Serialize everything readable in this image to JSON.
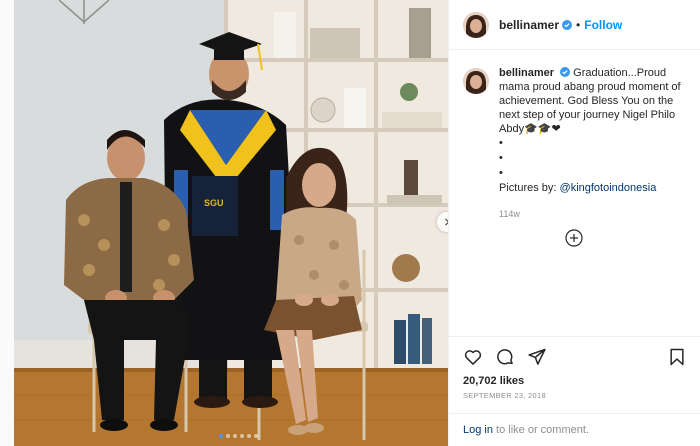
{
  "post": {
    "username": "bellinamer",
    "follow_label": "Follow",
    "separator": "•",
    "caption_text": "Graduation...Proud mama proud abang proud moment of achievement. God Bless You on the next step of your journey Nigel Philo Abdy🎓🎓❤",
    "caption_bullets": [
      "•",
      "•",
      "•"
    ],
    "credit_prefix": "Pictures by: ",
    "credit_mention": "@kingfotoindonesia",
    "time_ago": "114w",
    "likes": "20,702 likes",
    "date": "SEPTEMBER 23, 2018",
    "login_link": "Log in",
    "login_suffix": " to like or comment."
  },
  "photo": {
    "diploma_text": "SGU",
    "carousel_dots": 6,
    "active_dot": 0
  },
  "icons": [
    "verified-icon",
    "heart-icon",
    "comment-icon",
    "share-icon",
    "bookmark-icon",
    "add-comment-icon",
    "chevron-right-icon"
  ],
  "colors": {
    "link_blue": "#0095f6",
    "mention_blue": "#00376b",
    "muted": "#8e8e8e",
    "text": "#262626"
  }
}
